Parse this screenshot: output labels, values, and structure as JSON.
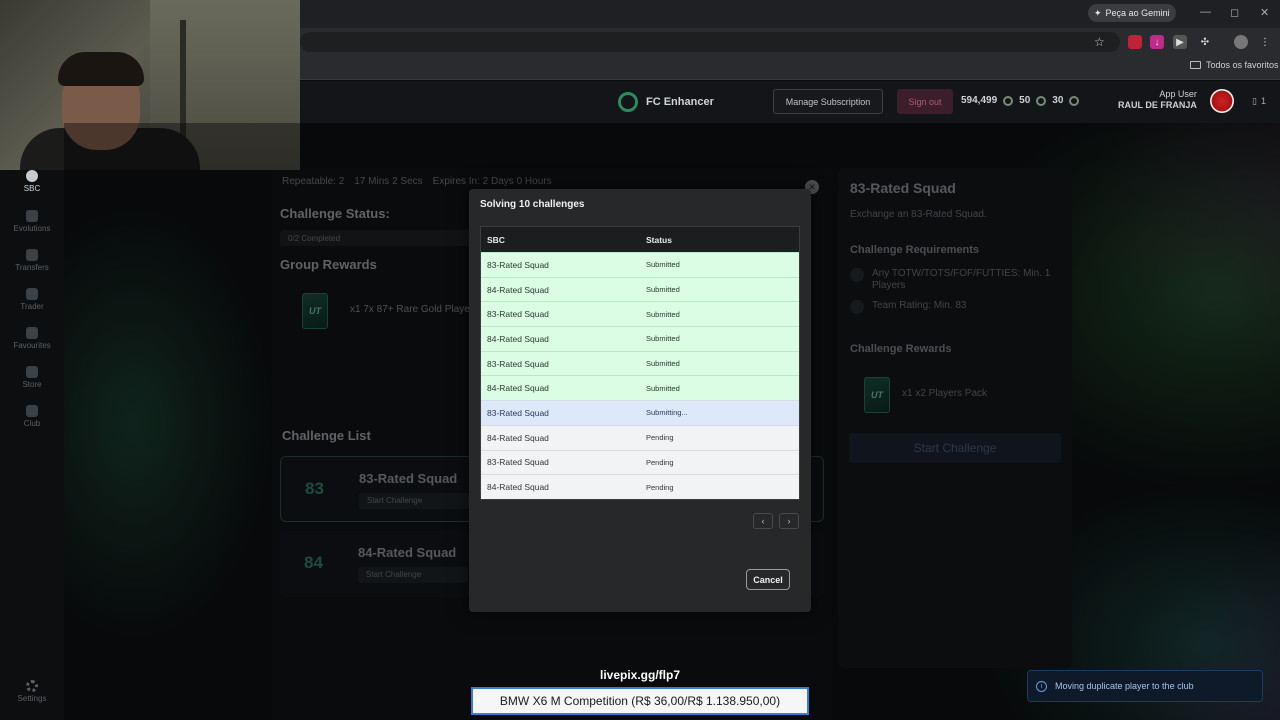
{
  "browser": {
    "gemini_label": "Peça ao Gemini",
    "bookmarks_label": "Todos os favoritos",
    "window_controls": [
      "—",
      "◻",
      "✕"
    ]
  },
  "header": {
    "brand": "FC Enhancer",
    "manage_label": "Manage Subscription",
    "signout_label": "Sign out",
    "coins": "594,499",
    "points": "50",
    "tokens": "30",
    "user_role": "App User",
    "user_name": "RAUL DE FRANJA",
    "notif_count": "1"
  },
  "nav": {
    "items": [
      "SBC",
      "Evolutions",
      "Transfers",
      "Trader",
      "Favourites",
      "Store",
      "Club"
    ],
    "settings": "Settings"
  },
  "sbc": {
    "repeatable": "Repeatable: 2",
    "time": "17 Mins 2 Secs",
    "expires": "Expires In: 2 Days 0 Hours",
    "status_heading": "Challenge Status:",
    "progress": "0/2 Completed",
    "group_rewards_heading": "Group Rewards",
    "group_reward": "x1 7x 87+ Rare Gold Player",
    "list_heading": "Challenge List",
    "challenges": [
      {
        "num": "83",
        "name": "83-Rated Squad",
        "btn": "Start Challenge"
      },
      {
        "num": "84",
        "name": "84-Rated Squad",
        "btn": "Start Challenge"
      }
    ],
    "card_logo": "UT"
  },
  "detail": {
    "title": "83-Rated Squad",
    "subtitle": "Exchange an 83-Rated Squad.",
    "req_heading": "Challenge Requirements",
    "req1": "Any TOTW/TOTS/FOF/FUTTIES: Min. 1 Players",
    "req2": "Team Rating: Min. 83",
    "rewards_heading": "Challenge Rewards",
    "reward": "x1 x2 Players Pack",
    "start_label": "Start Challenge"
  },
  "modal": {
    "title": "Solving 10 challenges",
    "col_sbc": "SBC",
    "col_status": "Status",
    "rows": [
      {
        "sbc": "83-Rated Squad",
        "status": "Submitted"
      },
      {
        "sbc": "84-Rated Squad",
        "status": "Submitted"
      },
      {
        "sbc": "83-Rated Squad",
        "status": "Submitted"
      },
      {
        "sbc": "84-Rated Squad",
        "status": "Submitted"
      },
      {
        "sbc": "83-Rated Squad",
        "status": "Submitted"
      },
      {
        "sbc": "84-Rated Squad",
        "status": "Submitted"
      },
      {
        "sbc": "83-Rated Squad",
        "status": "Submitting..."
      },
      {
        "sbc": "84-Rated Squad",
        "status": "Pending"
      },
      {
        "sbc": "83-Rated Squad",
        "status": "Pending"
      },
      {
        "sbc": "84-Rated Squad",
        "status": "Pending"
      }
    ],
    "prev": "‹",
    "next": "›",
    "cancel_label": "Cancel"
  },
  "overlay": {
    "stream_url": "livepix.gg/flp7",
    "donation": "BMW X6 M Competition (R$ 36,00/R$ 1.138.950,00)",
    "toast": "Moving duplicate player to the club",
    "toast_icon": "i"
  }
}
